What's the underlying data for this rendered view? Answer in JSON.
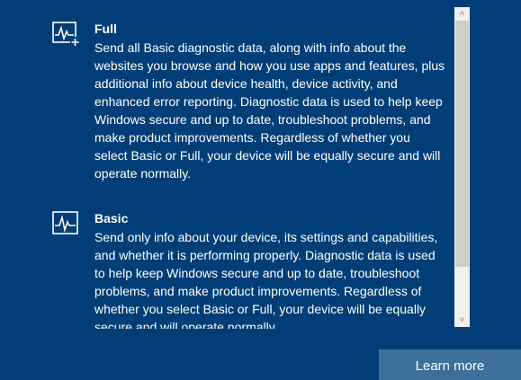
{
  "options": [
    {
      "id": "full",
      "icon": "activity-plus-icon",
      "title": "Full",
      "description": "Send all Basic diagnostic data, along with info about the websites you browse and how you use apps and features, plus additional info about device health, device activity, and enhanced error reporting. Diagnostic data is used to help keep Windows secure and up to date, troubleshoot problems, and make product improvements. Regardless of whether you select Basic or Full, your device will be equally secure and will operate normally."
    },
    {
      "id": "basic",
      "icon": "activity-icon",
      "title": "Basic",
      "description": "Send only info about your device, its settings and capabilities, and whether it is performing properly. Diagnostic data is used to help keep Windows secure and up to date, troubleshoot problems, and make product improvements. Regardless of whether you select Basic or Full, your device will be equally secure and will operate normally."
    }
  ],
  "scrollbar": {
    "position": 0.0,
    "visible_fraction": 0.84,
    "up_glyph": "˄",
    "down_glyph": "˅"
  },
  "footer": {
    "learn_more_label": "Learn more"
  },
  "colors": {
    "background": "#013e77",
    "button": "#3e6f9a",
    "scroll_track": "#f0f0f0",
    "scroll_thumb": "#cdcdcd",
    "text": "#ffffff"
  }
}
